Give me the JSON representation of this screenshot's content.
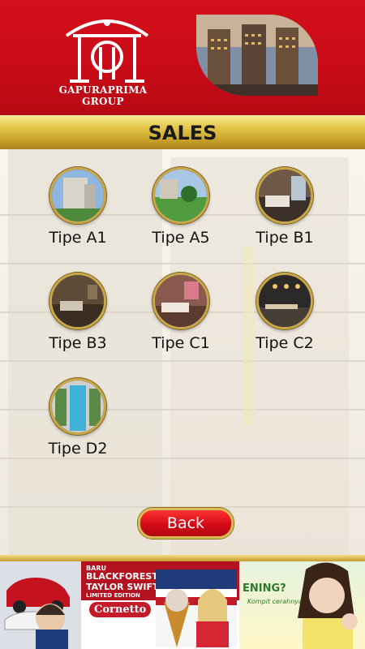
{
  "header": {
    "brand": "GAPURAPRIMA GROUP",
    "logo_icon": "gapuraprima-gate-logo",
    "hero_image": "city-towers-photo",
    "accent": "#d40f1b",
    "gold": "#c9a22b"
  },
  "title": "SALES",
  "types": [
    {
      "label": "Tipe A1",
      "icon": "building-exterior-thumb"
    },
    {
      "label": "Tipe A5",
      "icon": "garden-view-thumb"
    },
    {
      "label": "Tipe B1",
      "icon": "bedroom-thumb"
    },
    {
      "label": "Tipe B3",
      "icon": "living-room-thumb"
    },
    {
      "label": "Tipe C1",
      "icon": "bedroom-pink-thumb"
    },
    {
      "label": "Tipe C2",
      "icon": "kitchen-thumb"
    },
    {
      "label": "Tipe D2",
      "icon": "pool-thumb"
    }
  ],
  "back_button": {
    "label": "Back"
  },
  "footer_ads": [
    {
      "name": "car-ad",
      "text": ""
    },
    {
      "name": "cornetto-ad",
      "line1": "BARU",
      "line2": "BLACKFOREST RED",
      "line3": "TAYLOR SWIFT",
      "line4": "LIMITED EDITION",
      "brand": "Cornetto"
    },
    {
      "name": "skincare-ad",
      "line1": "ENING?",
      "line2": "Kompit cerahnya!"
    }
  ]
}
